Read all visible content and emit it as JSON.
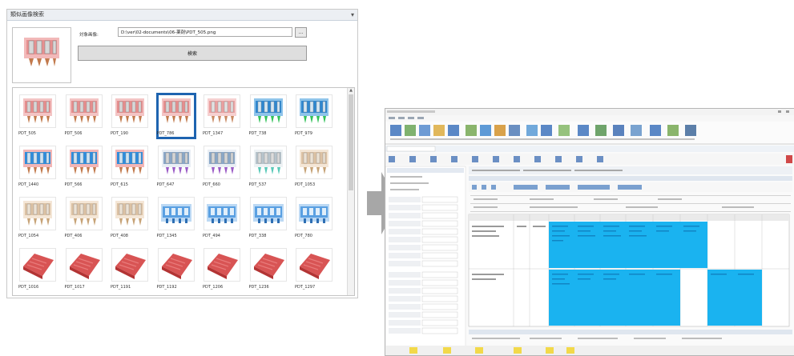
{
  "panel": {
    "title": "類似画像検索",
    "target_label": "対象画像:",
    "path_value": "D:\\ver\\02-documents\\06-薬剤\\PDT_505.png",
    "browse_label": "...",
    "search_label": "検索"
  },
  "results": [
    {
      "label": "PDT_505",
      "kind": "pink"
    },
    {
      "label": "PDT_506",
      "kind": "pink"
    },
    {
      "label": "PDT_190",
      "kind": "pink"
    },
    {
      "label": "PDT_786",
      "kind": "pink",
      "selected": true
    },
    {
      "label": "PDT_1347",
      "kind": "pink2"
    },
    {
      "label": "PDT_738",
      "kind": "bluegreen"
    },
    {
      "label": "PDT_979",
      "kind": "bluegreen"
    },
    {
      "label": "PDT_1440",
      "kind": "bluepink"
    },
    {
      "label": "PDT_566",
      "kind": "bluepink"
    },
    {
      "label": "PDT_615",
      "kind": "bluepink"
    },
    {
      "label": "PDT_647",
      "kind": "purple"
    },
    {
      "label": "PDT_660",
      "kind": "purple"
    },
    {
      "label": "PDT_537",
      "kind": "teal"
    },
    {
      "label": "PDT_1053",
      "kind": "beige"
    },
    {
      "label": "PDT_1054",
      "kind": "beige"
    },
    {
      "label": "PDT_406",
      "kind": "beige"
    },
    {
      "label": "PDT_408",
      "kind": "beige"
    },
    {
      "label": "PDT_1345",
      "kind": "blue"
    },
    {
      "label": "PDT_494",
      "kind": "blue"
    },
    {
      "label": "PDT_338",
      "kind": "blue"
    },
    {
      "label": "PDT_780",
      "kind": "blue"
    },
    {
      "label": "PDT_1016",
      "kind": "red"
    },
    {
      "label": "PDT_1017",
      "kind": "red"
    },
    {
      "label": "PDT_1191",
      "kind": "red"
    },
    {
      "label": "PDT_1192",
      "kind": "red"
    },
    {
      "label": "PDT_1206",
      "kind": "red"
    },
    {
      "label": "PDT_1236",
      "kind": "red"
    },
    {
      "label": "PDT_1297",
      "kind": "red"
    }
  ],
  "colors": {
    "selection": "#1e64b0",
    "arrow": "#a7a7a7",
    "highlight_cells": "#1ab3f0"
  }
}
